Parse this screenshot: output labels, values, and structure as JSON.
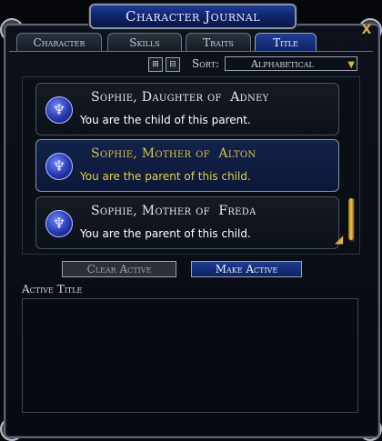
{
  "window": {
    "title": "Character Journal",
    "close_label": "X"
  },
  "tabs": [
    {
      "label": "Character",
      "active": false
    },
    {
      "label": "Skills",
      "active": false
    },
    {
      "label": "Traits",
      "active": false
    },
    {
      "label": "Title",
      "active": true
    }
  ],
  "toolbar": {
    "sort_label": "Sort:",
    "sort_value": "Alphabetical",
    "expand_icon": "expand-all-icon",
    "collapse_icon": "collapse-all-icon"
  },
  "titles": [
    {
      "name": "Sophie, Daughter of  Adney",
      "description": "You are the child of this parent.",
      "selected": false,
      "icon": "white-tree-icon"
    },
    {
      "name": "Sophie, Mother of  Alton",
      "description": "You are the parent of this child.",
      "selected": true,
      "icon": "white-tree-icon"
    },
    {
      "name": "Sophie, Mother of  Freda",
      "description": "You are the parent of this child.",
      "selected": false,
      "icon": "white-tree-icon"
    }
  ],
  "buttons": {
    "clear_active": "Clear Active",
    "make_active": "Make Active"
  },
  "active_title": {
    "label": "Active Title",
    "value": ""
  },
  "colors": {
    "accent_blue": "#0e2266",
    "selected_text": "#e6d040",
    "gold": "#d8b04a"
  }
}
